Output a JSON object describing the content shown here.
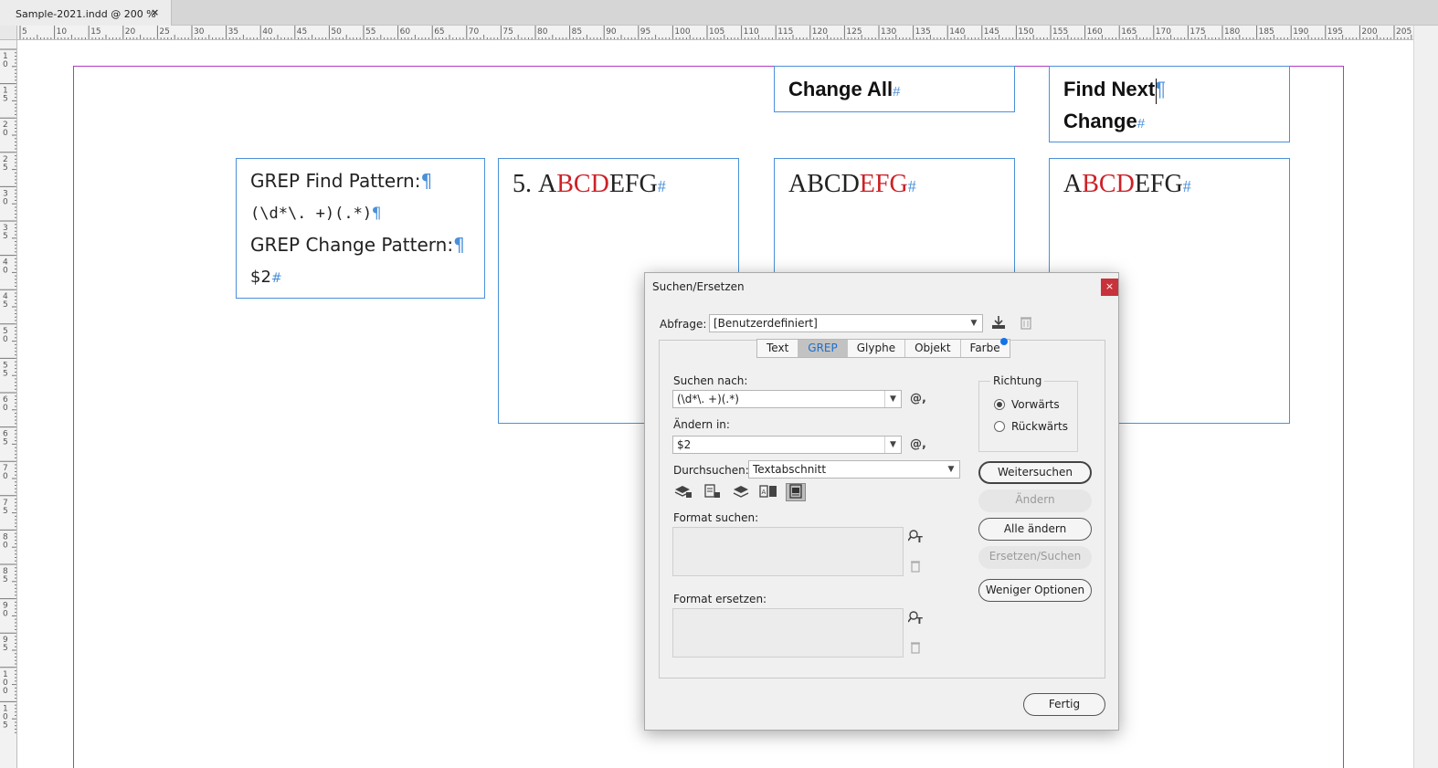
{
  "document_tab": {
    "title": "Sample-2021.indd @ 200 %",
    "close": "×"
  },
  "ruler": {
    "h_labels": [
      "5",
      "10",
      "15",
      "20",
      "25",
      "30",
      "35",
      "40",
      "45",
      "50",
      "55",
      "60",
      "65",
      "70",
      "75",
      "80",
      "85",
      "90",
      "95",
      "100",
      "105",
      "110",
      "115",
      "120",
      "125",
      "130",
      "135",
      "140",
      "145",
      "150",
      "155",
      "160",
      "165",
      "170",
      "175",
      "180",
      "185",
      "190",
      "195",
      "200",
      "205"
    ],
    "v_labels": [
      "1 0",
      "1 5",
      "2 0",
      "2 5",
      "3 0",
      "3 5",
      "4 0",
      "4 5",
      "5 0",
      "5 5",
      "6 0",
      "6 5",
      "7 0",
      "7 5",
      "8 0",
      "8 5",
      "9 0",
      "9 5",
      "1 0 0",
      "1 0 5"
    ]
  },
  "frames": {
    "change_all": {
      "text": "Change All",
      "mark": "#"
    },
    "find_next": {
      "line1": "Find Next",
      "mark1": "¶",
      "line2": "Change",
      "mark2": "#"
    },
    "pattern": {
      "line1": "GREP Find Pattern:",
      "line2": "(\\d*\\. +)(.*)",
      "line3": "GREP Change Pattern:",
      "line4": "$2",
      "pilcrow": "¶",
      "hash": "#"
    },
    "sample1": {
      "num": "5.",
      "a": "A",
      "red": "BCD",
      "rest": "EFG",
      "mark": "#"
    },
    "sample2": {
      "black": "ABCD",
      "red": "EFG",
      "mark": "#"
    },
    "sample3": {
      "a": "A",
      "red": "BCD",
      "rest": "EFG",
      "mark": "#"
    }
  },
  "dialog": {
    "title": "Suchen/Ersetzen",
    "close": "×",
    "query_label": "Abfrage:",
    "query_value": "[Benutzerdefiniert]",
    "tabs": [
      "Text",
      "GREP",
      "Glyphe",
      "Objekt",
      "Farbe"
    ],
    "active_tab": "GREP",
    "find_label": "Suchen nach:",
    "find_value": "(\\d*\\. +)(.*)",
    "change_label": "Ändern in:",
    "change_value": "$2",
    "search_label": "Durchsuchen:",
    "search_value": "Textabschnitt",
    "direction_title": "Richtung",
    "direction_forward": "Vorwärts",
    "direction_backward": "Rückwärts",
    "format_find_label": "Format suchen:",
    "format_change_label": "Format ersetzen:",
    "buttons": {
      "find_next": "Weitersuchen",
      "change": "Ändern",
      "change_all": "Alle ändern",
      "change_find": "Ersetzen/Suchen",
      "fewer_options": "Weniger Optionen",
      "done": "Fertig"
    },
    "at_symbol": "@,",
    "colors": {
      "accent": "#1473e6",
      "close": "#c8323a"
    }
  }
}
